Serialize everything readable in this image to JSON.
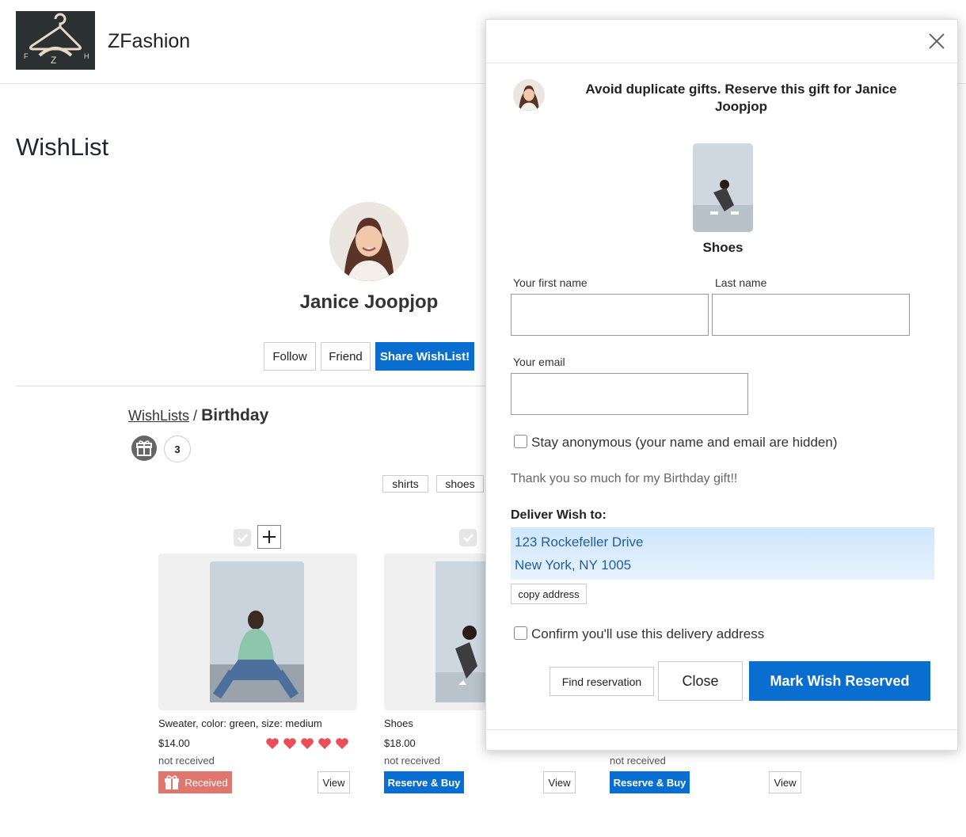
{
  "header": {
    "brand": "ZFashion",
    "logo_letters": [
      "F",
      "Z",
      "H"
    ]
  },
  "page": {
    "title": "WishList"
  },
  "profile": {
    "name": "Janice Joopjop",
    "buttons": {
      "follow": "Follow",
      "friend": "Friend",
      "share": "Share WishList!"
    }
  },
  "breadcrumb": {
    "root": "WishLists",
    "separator": "/",
    "current": "Birthday"
  },
  "gift_count": "3",
  "tags": [
    "shirts",
    "shoes"
  ],
  "items": [
    {
      "title": "Sweater, color: green, size: medium",
      "price": "$14.00",
      "status": "not received",
      "action": "Received",
      "view": "View",
      "hearts": 5
    },
    {
      "title": "Shoes",
      "price": "$18.00",
      "status": "not received",
      "action": "Reserve & Buy",
      "view": "View"
    },
    {
      "status": "not received",
      "action": "Reserve & Buy",
      "view": "View"
    }
  ],
  "modal": {
    "heading": "Avoid duplicate gifts. Reserve this gift for Janice Joopjop",
    "wish_name": "Shoes",
    "first_name_label": "Your first name",
    "last_name_label": "Last name",
    "email_label": "Your email",
    "anonymous_label": "Stay anonymous (your name and email are hidden)",
    "thanks": "Thank you so much for my Birthday gift!!",
    "deliver_label": "Deliver Wish to:",
    "address_line1": "123 Rockefeller Drive",
    "address_line2": "New York, NY 1005",
    "copy_label": "copy address",
    "confirm_label": "Confirm you'll use this delivery address",
    "find_label": "Find reservation",
    "close_label": "Close",
    "reserve_label": "Mark Wish Reserved"
  },
  "colors": {
    "primary": "#0a6ed1",
    "received": "#e0776f",
    "heart": "#ea4f59",
    "address_bg": "#d8ebfc"
  }
}
